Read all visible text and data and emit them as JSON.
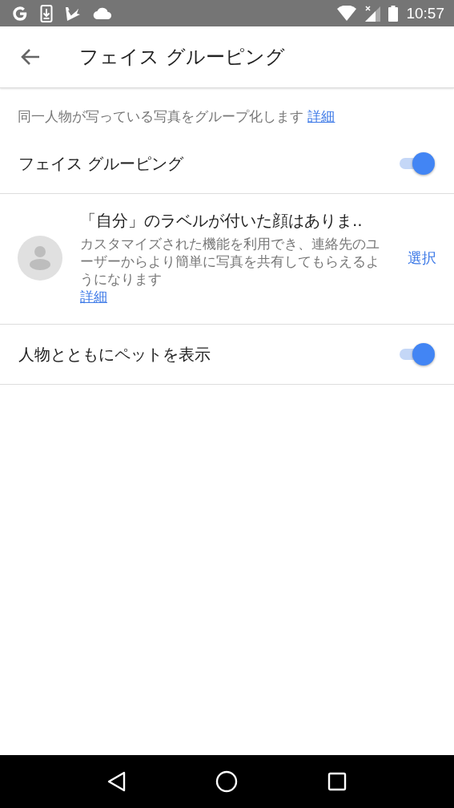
{
  "status_bar": {
    "time": "10:57"
  },
  "app_bar": {
    "title": "フェイス グルーピング"
  },
  "intro": {
    "text": "同一人物が写っている写真をグループ化します",
    "link": "詳細"
  },
  "settings": [
    {
      "kind": "toggle",
      "label": "フェイス グルーピング",
      "on": true
    },
    {
      "kind": "self_label",
      "title": "「自分」のラベルが付いた顔はありま..",
      "description": "カスタマイズされた機能を利用でき、連絡先のユーザーからより簡単に写真を共有してもらえるようになります",
      "link": "詳細",
      "action": "選択"
    },
    {
      "kind": "toggle",
      "label": "人物とともにペットを表示",
      "on": true
    }
  ]
}
